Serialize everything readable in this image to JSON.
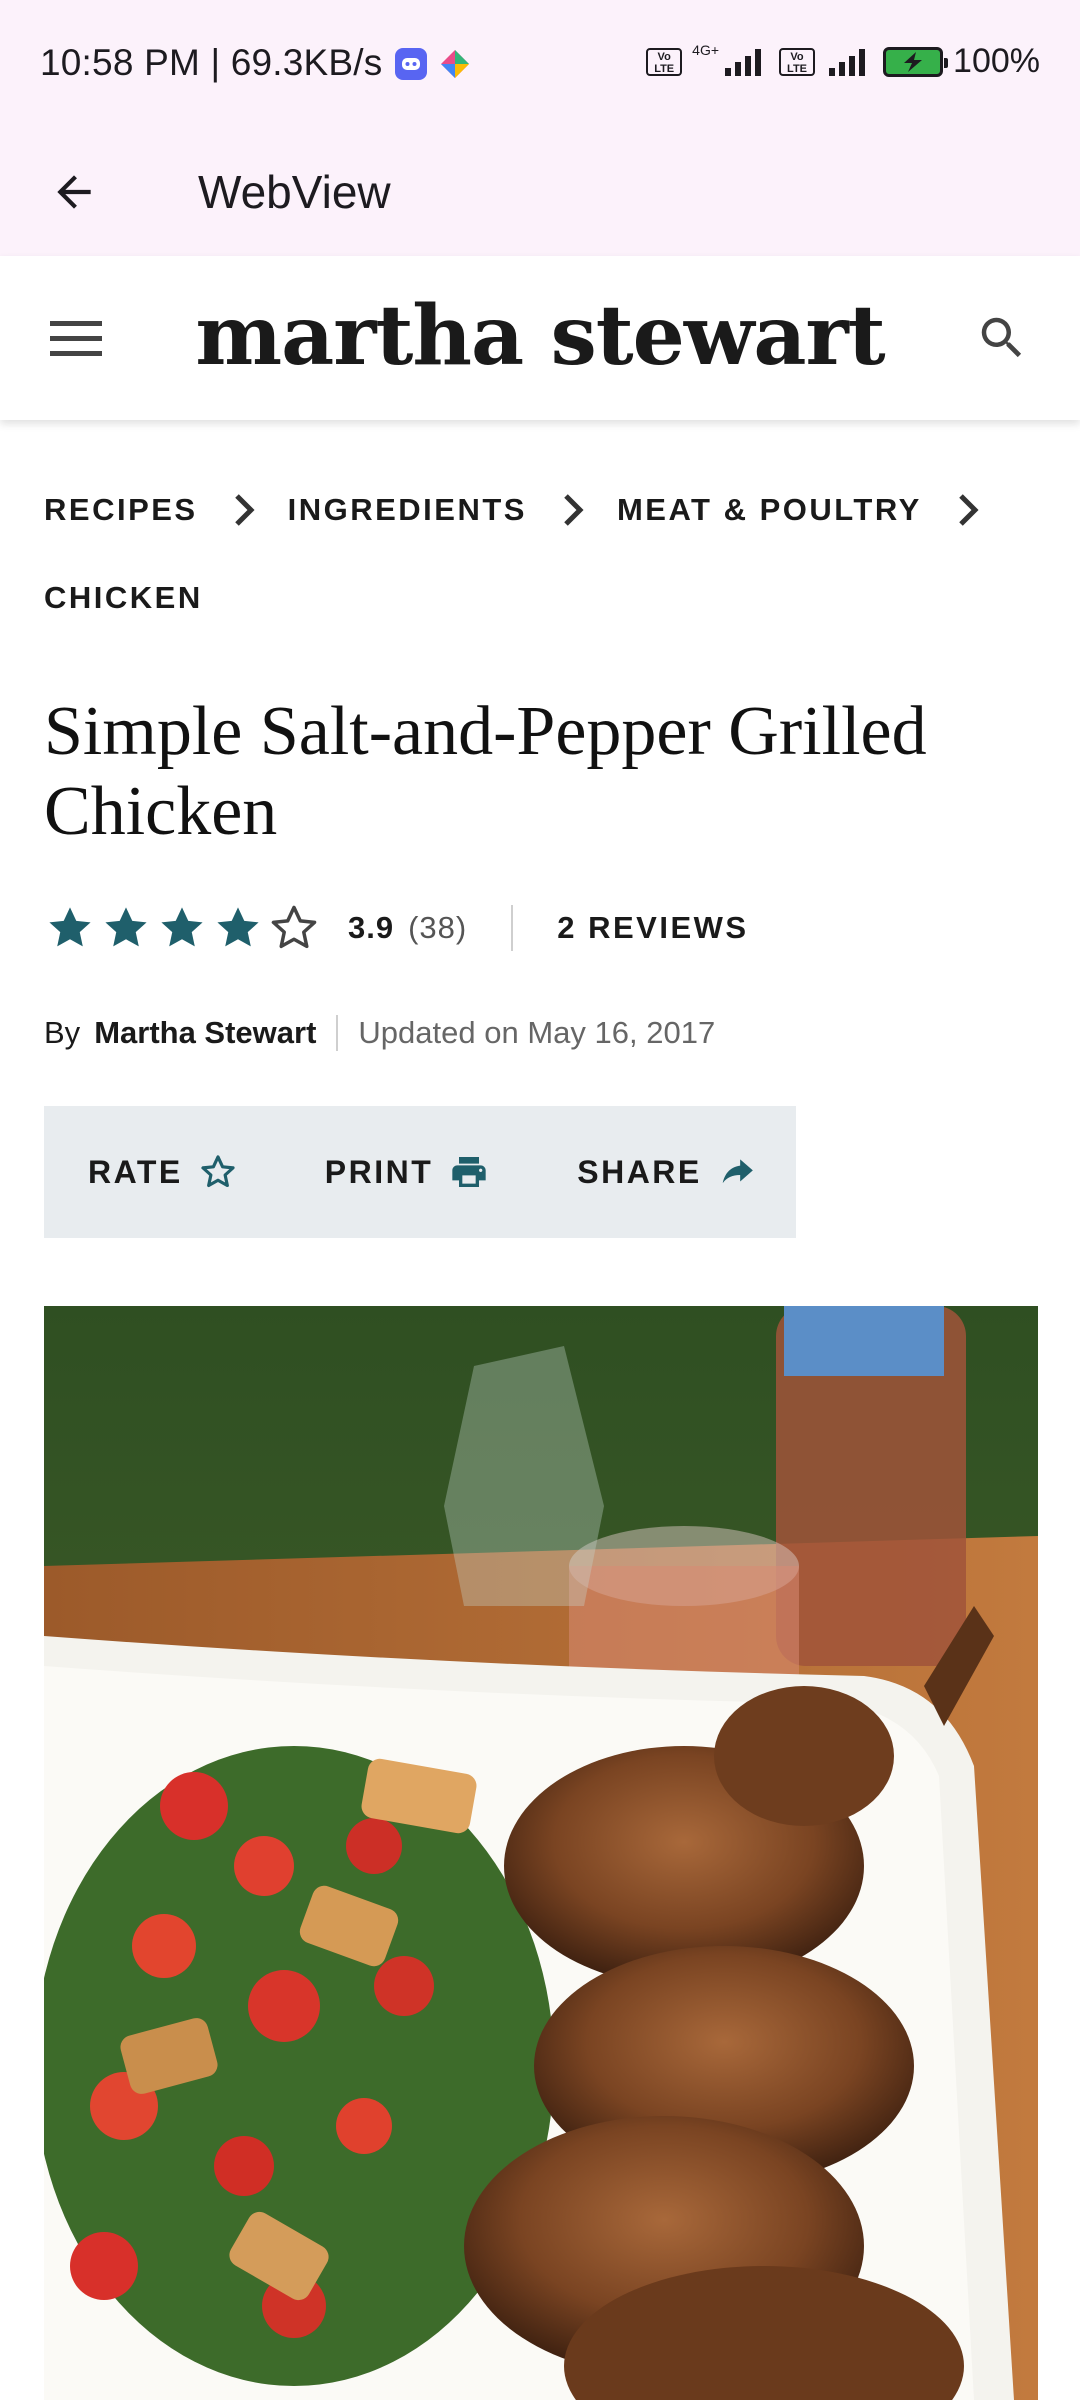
{
  "status_bar": {
    "time_speed": "10:58 PM | 69.3KB/s",
    "network_type": "4G+",
    "volte_label": "Vo LTE",
    "battery_text": "100%",
    "battery_color": "#36b04a"
  },
  "app_bar": {
    "back_icon": "arrow-left-icon",
    "title": "WebView"
  },
  "site_header": {
    "menu_icon": "hamburger-menu-icon",
    "logo_text": "martha stewart",
    "search_icon": "search-icon"
  },
  "breadcrumb": [
    {
      "label": "RECIPES"
    },
    {
      "label": "INGREDIENTS"
    },
    {
      "label": "MEAT & POULTRY"
    },
    {
      "label": "CHICKEN"
    }
  ],
  "recipe": {
    "title": "Simple Salt-and-Pepper Grilled Chicken",
    "rating": {
      "filled_stars": 4,
      "total_stars": 5,
      "value": "3.9",
      "count": "(38)",
      "reviews_label": "2 REVIEWS",
      "star_color": "#1f5f6b"
    },
    "byline": {
      "by": "By",
      "author": "Martha Stewart",
      "updated": "Updated on May 16, 2017"
    }
  },
  "actions": {
    "rate_label": "RATE",
    "print_label": "PRINT",
    "share_label": "SHARE"
  },
  "hero_image": {
    "subject": "grilled chicken with bread salad on a white platter"
  }
}
